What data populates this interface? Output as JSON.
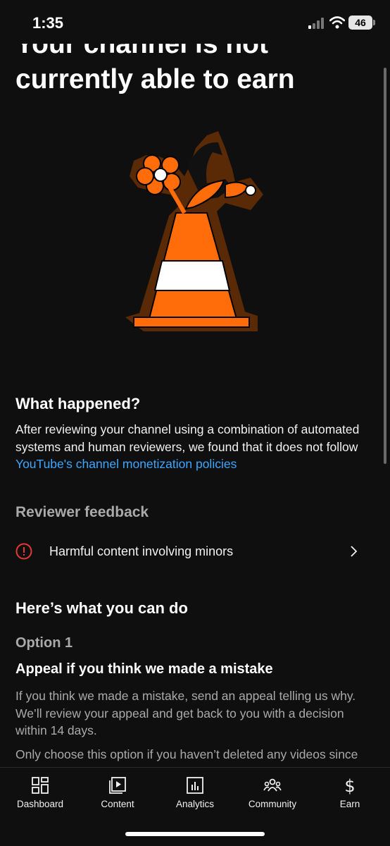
{
  "status_bar": {
    "time": "1:35",
    "battery": "46"
  },
  "page": {
    "title": "Your channel is not currently able to earn",
    "what_happened_heading": "What happened?",
    "what_happened_text": "After reviewing your channel using a combination of automated systems and human reviewers, we found that it does not follow ",
    "policy_link": "YouTube's channel monetization policies",
    "reviewer_feedback_heading": "Reviewer feedback",
    "feedback_item": "Harmful content involving minors",
    "what_you_can_do_heading": "Here’s what you can do",
    "option_label": "Option 1",
    "option_heading": "Appeal if you think we made a mistake",
    "option_text": "If you think we made a mistake, send an appeal telling us why. We’ll review your appeal and get back to you with a decision within 14 days.",
    "only_text": "Only choose this option if you haven’t deleted any videos since you applied or were suspended from"
  },
  "bottom_nav": {
    "items": [
      {
        "label": "Dashboard",
        "icon": "dashboard-icon"
      },
      {
        "label": "Content",
        "icon": "content-icon"
      },
      {
        "label": "Analytics",
        "icon": "analytics-icon"
      },
      {
        "label": "Community",
        "icon": "community-icon"
      },
      {
        "label": "Earn",
        "icon": "earn-icon"
      }
    ]
  },
  "colors": {
    "background": "#0f0f0f",
    "link": "#3ea6ff",
    "alert": "#e53935",
    "cone_orange": "#ff6d0a",
    "cone_outline": "#5a2a06"
  }
}
